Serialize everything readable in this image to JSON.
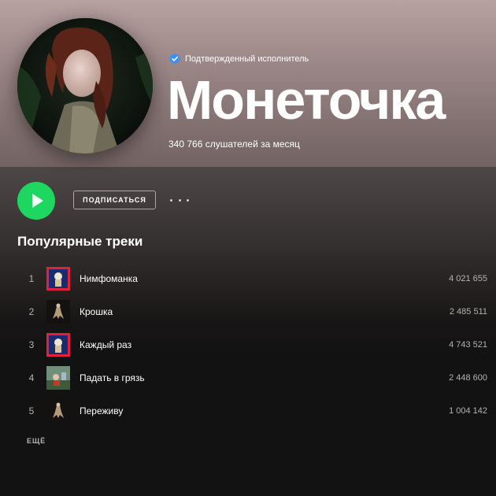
{
  "artist": {
    "verified_label": "Подтвержденный исполнитель",
    "name": "Монеточка",
    "monthly_listeners": "340 766 слушателей за месяц"
  },
  "actions": {
    "follow_label": "ПОДПИСАТЬСЯ",
    "play_icon": "play-icon",
    "more_icon": "more-options-icon"
  },
  "popular": {
    "title": "Популярные треки",
    "see_more_label": "ЕЩЁ",
    "tracks": [
      {
        "number": "1",
        "title": "Нимфоманка",
        "plays": "4 021 655",
        "cover": "red-cover"
      },
      {
        "number": "2",
        "title": "Крошка",
        "plays": "2 485 511",
        "cover": "dark-cover"
      },
      {
        "number": "3",
        "title": "Каждый раз",
        "plays": "4 743 521",
        "cover": "red-cover"
      },
      {
        "number": "4",
        "title": "Падать в грязь",
        "plays": "2 448 600",
        "cover": "green-cover"
      },
      {
        "number": "5",
        "title": "Переживу",
        "plays": "1 004 142",
        "cover": "dark-cover"
      }
    ]
  },
  "colors": {
    "accent_green": "#1ed760",
    "hero_background": "#a48e8e",
    "page_background": "#121212",
    "verified_blue": "#3d91f4"
  }
}
